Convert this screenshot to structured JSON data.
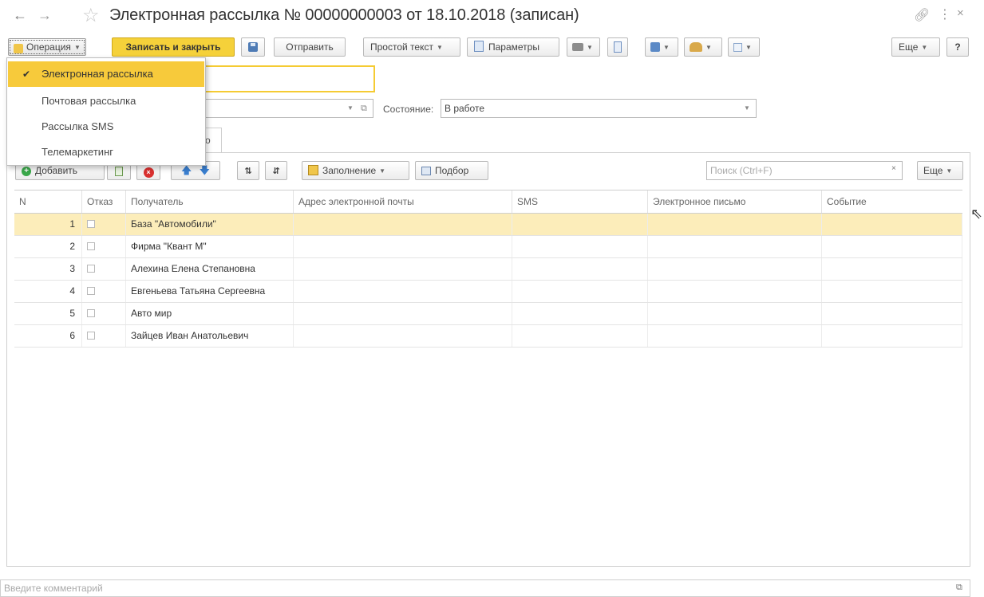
{
  "window": {
    "title": "Электронная рассылка № 00000000003 от 18.10.2018 (записан)"
  },
  "toolbar": {
    "operation": "Операция",
    "save_close": "Записать и закрыть",
    "send": "Отправить",
    "text_format": "Простой текст",
    "parameters": "Параметры",
    "more": "Еще",
    "help": "?"
  },
  "operation_menu": {
    "items": [
      {
        "label": "Электронная рассылка",
        "selected": true
      },
      {
        "label": "Почтовая рассылка",
        "selected": false
      },
      {
        "label": "Рассылка SMS",
        "selected": false
      },
      {
        "label": "Телемаркетинг",
        "selected": false
      }
    ]
  },
  "form": {
    "state_label": "Состояние:",
    "state_value": "В работе",
    "tab_fragment": "о"
  },
  "recipients_toolbar": {
    "add": "Добавить",
    "fill": "Заполнение",
    "pick": "Подбор",
    "search_placeholder": "Поиск (Ctrl+F)",
    "search_clear": "×",
    "more": "Еще"
  },
  "table": {
    "columns": [
      "N",
      "Отказ",
      "Получатель",
      "Адрес электронной почты",
      "SMS",
      "Электронное письмо",
      "Событие"
    ],
    "rows": [
      {
        "n": "1",
        "refused": false,
        "recipient": "База \"Автомобили\"",
        "email": "",
        "sms": "",
        "letter": "",
        "event": ""
      },
      {
        "n": "2",
        "refused": false,
        "recipient": "Фирма \"Квант М\"",
        "email": "",
        "sms": "",
        "letter": "",
        "event": ""
      },
      {
        "n": "3",
        "refused": false,
        "recipient": "Алехина Елена Степановна",
        "email": "",
        "sms": "",
        "letter": "",
        "event": ""
      },
      {
        "n": "4",
        "refused": false,
        "recipient": "Евгеньева Татьяна Сергеевна",
        "email": "",
        "sms": "",
        "letter": "",
        "event": ""
      },
      {
        "n": "5",
        "refused": false,
        "recipient": "Авто мир",
        "email": "",
        "sms": "",
        "letter": "",
        "event": ""
      },
      {
        "n": "6",
        "refused": false,
        "recipient": "Зайцев Иван Анатольевич",
        "email": "",
        "sms": "",
        "letter": "",
        "event": ""
      }
    ],
    "selected_row": 0
  },
  "footer": {
    "comment_placeholder": "Введите комментарий"
  },
  "colors": {
    "accent": "#f5d13a",
    "selected_row": "#fcedba",
    "menu_selected": "#f7ca3b"
  },
  "icons": {
    "back": "arrow-left-icon",
    "forward": "arrow-right-icon",
    "favorite": "star-icon",
    "link": "link-icon",
    "more": "more-vertical-icon",
    "close": "close-icon"
  }
}
